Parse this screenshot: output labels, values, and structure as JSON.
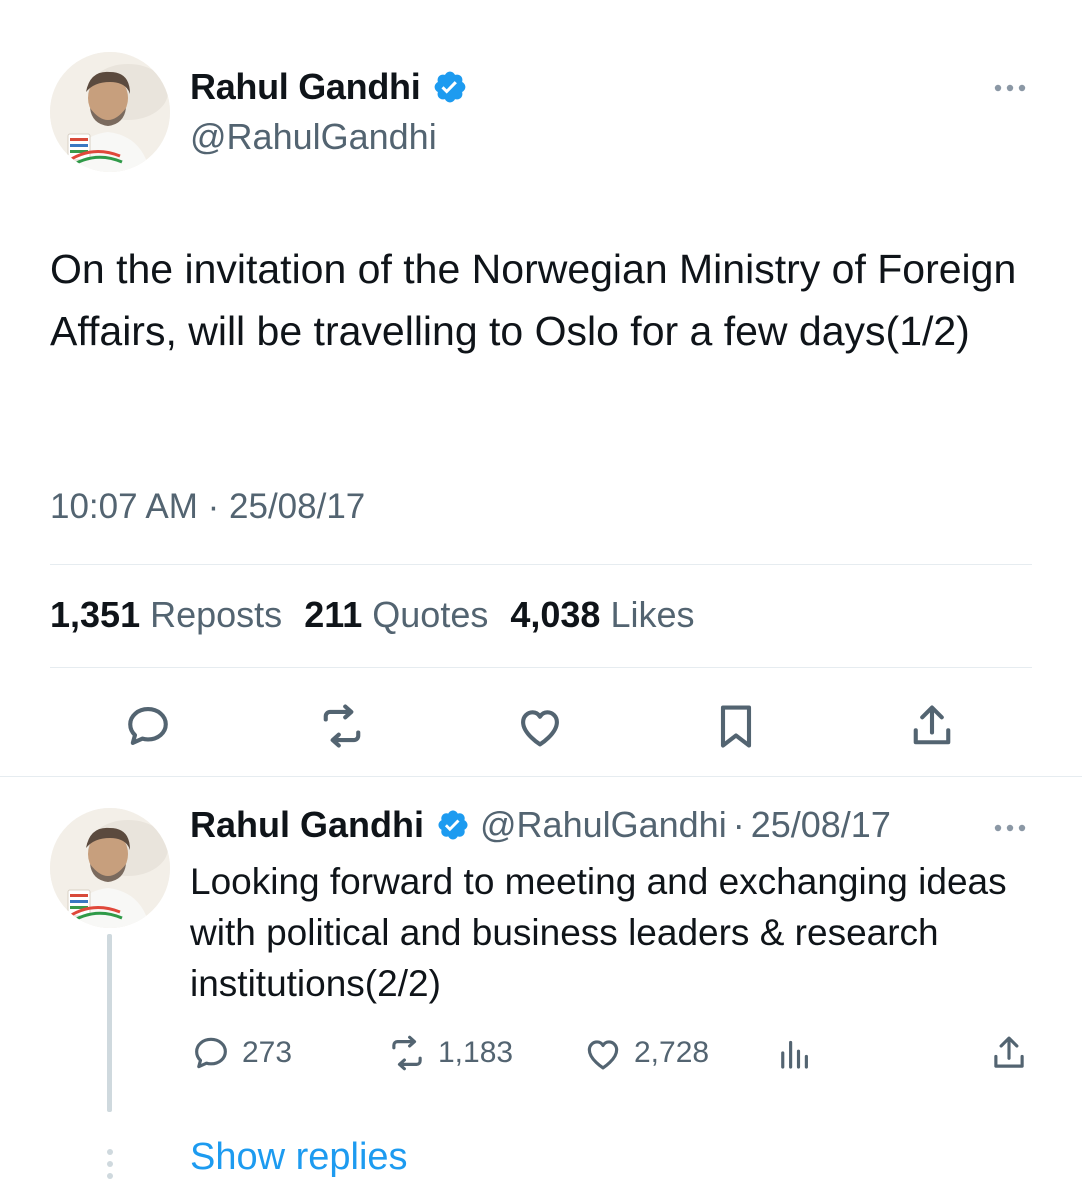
{
  "main_tweet": {
    "author_name": "Rahul Gandhi",
    "handle": "@RahulGandhi",
    "text": "On the invitation of the Norwegian Ministry of Foreign Affairs, will be travelling to Oslo for a few days(1/2)",
    "time": "10:07 AM",
    "separator": "·",
    "date": "25/08/17",
    "stats": {
      "reposts_count": "1,351",
      "reposts_label": "Reposts",
      "quotes_count": "211",
      "quotes_label": "Quotes",
      "likes_count": "4,038",
      "likes_label": "Likes"
    },
    "actions": [
      "reply-icon",
      "repost-icon",
      "like-icon",
      "bookmark-icon",
      "share-icon"
    ]
  },
  "reply_tweet": {
    "author_name": "Rahul Gandhi",
    "handle": "@RahulGandhi",
    "separator": "·",
    "date": "25/08/17",
    "text": "Looking forward to meeting and exchanging ideas with political and business leaders & research institutions(2/2)",
    "metrics": {
      "replies": "273",
      "reposts": "1,183",
      "likes": "2,728"
    }
  },
  "show_replies_label": "Show replies",
  "colors": {
    "text": "#0f1419",
    "secondary": "#536471",
    "accent": "#1d9bf0",
    "divider": "#e6ecf0"
  }
}
